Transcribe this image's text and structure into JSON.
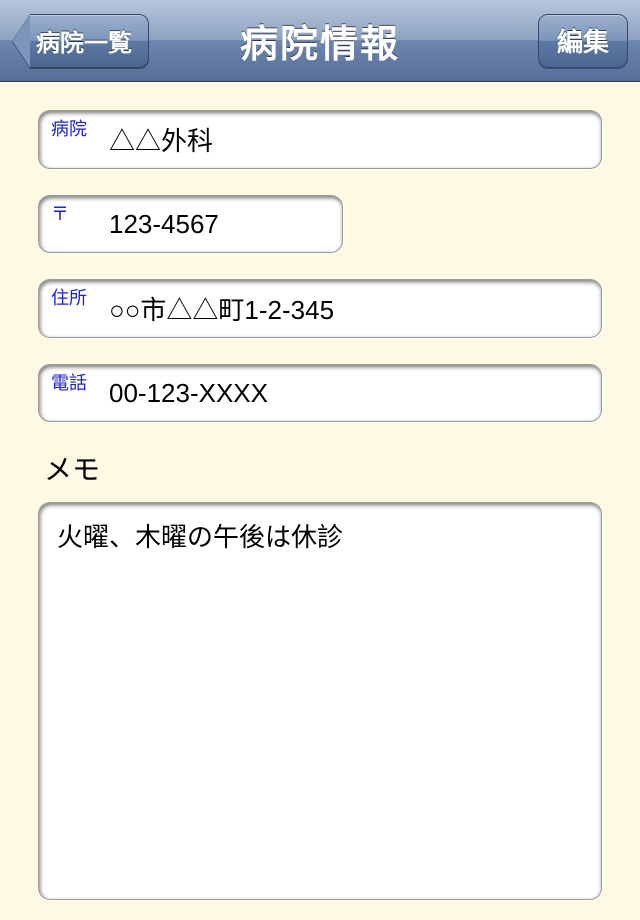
{
  "navbar": {
    "back_label": "病院一覧",
    "title": "病院情報",
    "edit_label": "編集"
  },
  "fields": {
    "hospital": {
      "label": "病院",
      "value": "△△外科"
    },
    "postal": {
      "label": "〒",
      "value": "123-4567"
    },
    "address": {
      "label": "住所",
      "value": "○○市△△町1-2-345"
    },
    "phone": {
      "label": "電話",
      "value": "00-123-XXXX"
    }
  },
  "memo": {
    "heading": "メモ",
    "body": "火曜、木曜の午後は休診"
  }
}
